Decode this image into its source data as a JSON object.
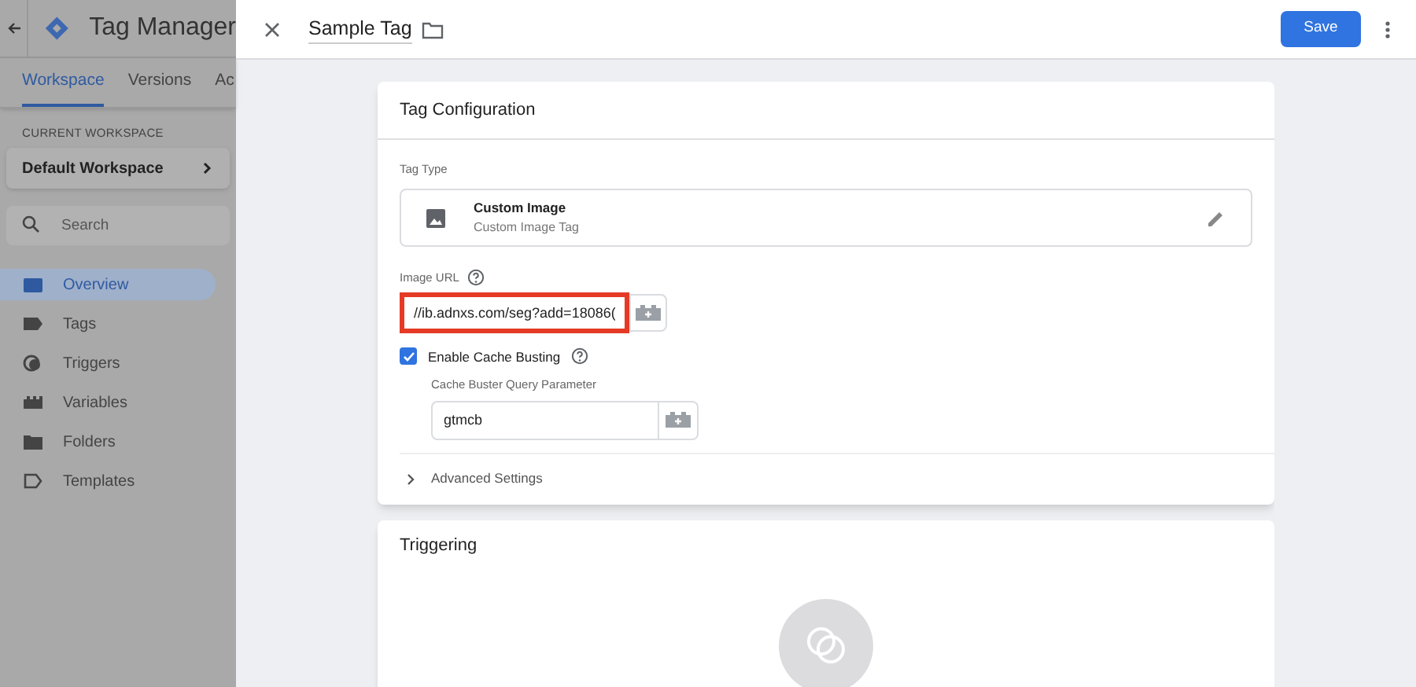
{
  "app": {
    "title": "Tag Manager"
  },
  "tabs": [
    {
      "label": "Workspace",
      "selected": true
    },
    {
      "label": "Versions",
      "selected": false
    },
    {
      "label": "Ac",
      "selected": false
    }
  ],
  "workspace": {
    "heading": "CURRENT WORKSPACE",
    "name": "Default Workspace"
  },
  "search": {
    "placeholder": "Search"
  },
  "nav": [
    {
      "label": "Overview",
      "kind": "overview",
      "selected": true
    },
    {
      "label": "Tags",
      "kind": "tags",
      "selected": false
    },
    {
      "label": "Triggers",
      "kind": "triggers",
      "selected": false
    },
    {
      "label": "Variables",
      "kind": "variables",
      "selected": false
    },
    {
      "label": "Folders",
      "kind": "folders",
      "selected": false
    },
    {
      "label": "Templates",
      "kind": "templates",
      "selected": false
    }
  ],
  "editor": {
    "name": "Sample Tag",
    "save": "Save"
  },
  "config": {
    "title": "Tag Configuration",
    "type_label": "Tag Type",
    "type_name": "Custom Image",
    "type_desc": "Custom Image Tag",
    "url_label": "Image URL",
    "url_value": "//ib.adnxs.com/seg?add=18086(",
    "cache_label": "Enable Cache Busting",
    "cache_checked": true,
    "param_label": "Cache Buster Query Parameter",
    "param_value": "gtmcb",
    "advanced": "Advanced Settings",
    "advanced_expanded": false
  },
  "triggering": {
    "title": "Triggering"
  }
}
